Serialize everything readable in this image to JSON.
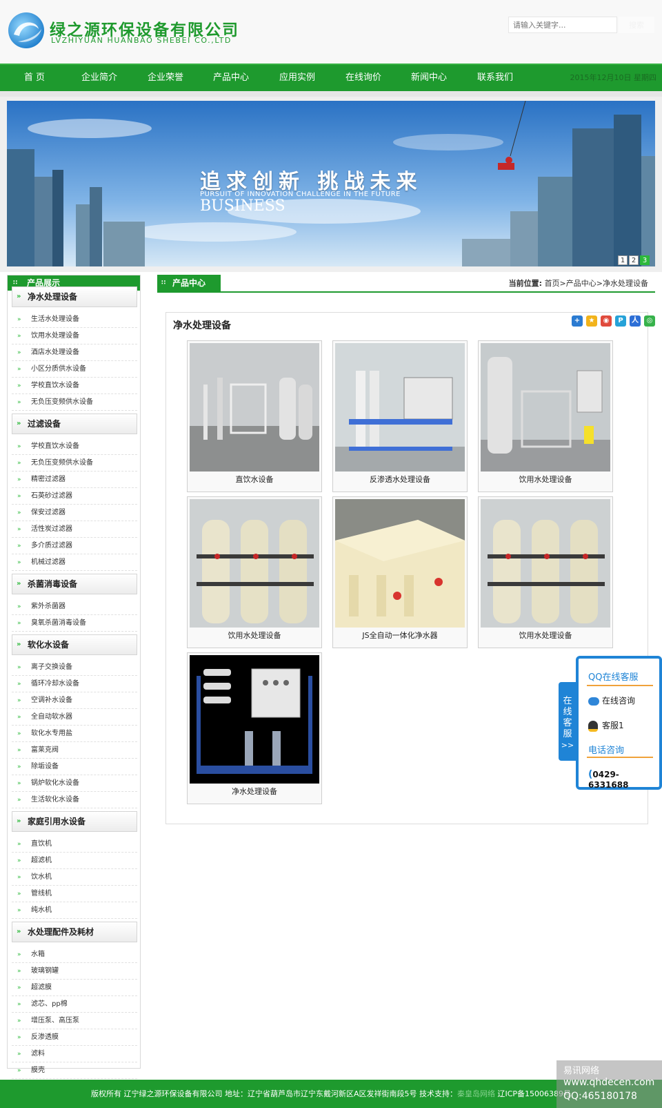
{
  "header": {
    "company_name": "绿之源环保设备有限公司",
    "company_name_en": "LVZHIYUAN HUANBAO SHEBEI CO.,LTD",
    "search_placeholder": "请输入关键字...",
    "search_button": "搜索"
  },
  "nav": {
    "items": [
      "首 页",
      "企业简介",
      "企业荣誉",
      "产品中心",
      "应用实例",
      "在线询价",
      "新闻中心",
      "联系我们"
    ],
    "date": "2015年12月10日 星期四"
  },
  "banner": {
    "headline": "追求创新 挑战未来",
    "subline": "PURSUIT OF INNOVATION CHALLENGE IN THE FUTURE",
    "word": "BUSINESS",
    "slides": [
      "1",
      "2",
      "3"
    ],
    "active_slide": 3
  },
  "sidebar": {
    "title": "产品展示",
    "categories": [
      {
        "name": "净水处理设备",
        "items": [
          "生活水处理设备",
          "饮用水处理设备",
          "酒店水处理设备",
          "小区分质供水设备",
          "学校直饮水设备",
          "无负压变频供水设备"
        ]
      },
      {
        "name": "过滤设备",
        "items": [
          "学校直饮水设备",
          "无负压变频供水设备",
          "精密过滤器",
          "石英砂过滤器",
          "保安过滤器",
          "活性炭过滤器",
          "多介质过滤器",
          "机械过滤器"
        ]
      },
      {
        "name": "杀菌消毒设备",
        "items": [
          "紫外杀菌器",
          "臭氧杀菌消毒设备"
        ]
      },
      {
        "name": "软化水设备",
        "items": [
          "离子交换设备",
          "循环冷却水设备",
          "空调补水设备",
          "全自动软水器",
          "软化水专用盐",
          "富莱克阀",
          "除垢设备",
          "锅炉软化水设备",
          "生活软化水设备"
        ]
      },
      {
        "name": "家庭引用水设备",
        "items": [
          "直饮机",
          "超滤机",
          "饮水机",
          "管线机",
          "纯水机"
        ]
      },
      {
        "name": "水处理配件及耗材",
        "items": [
          "水箱",
          "玻璃钢罐",
          "超滤膜",
          "滤芯、pp棉",
          "增压泵、高压泵",
          "反渗透膜",
          "滤料",
          "膜壳"
        ]
      }
    ]
  },
  "main": {
    "tab": "产品中心",
    "crumb_label": "当前位置:",
    "crumb_path": "首页>产品中心>净水处理设备",
    "title": "净水处理设备",
    "products": [
      "直饮水设备",
      "反渗透水处理设备",
      "饮用水处理设备",
      "饮用水处理设备",
      "JS全自动一体化净水器",
      "饮用水处理设备",
      "净水处理设备"
    ]
  },
  "qq": {
    "tab_label": "在线客服",
    "tab_arrow": ">>",
    "title": "QQ在线客服",
    "consult": "在线咨询",
    "agent": "客服1",
    "phone_title": "电话咨询",
    "phone": "0429-6331688"
  },
  "footer": {
    "text_a": "版权所有 辽宁绿之源环保设备有限公司 地址：辽宁省葫芦岛市辽宁东戴河新区A区发祥街南段5号 技术支持：",
    "tech": "秦皇岛网络",
    "text_b": " 辽ICP备15006389号"
  },
  "watermark": {
    "line1": "易讯网络",
    "line2": "www.qhdecen.com",
    "line3": "QQ:465180178"
  },
  "colors": {
    "primary_green": "#1e9a2e",
    "light_green": "#2db93b",
    "qq_blue": "#1f84d6"
  }
}
